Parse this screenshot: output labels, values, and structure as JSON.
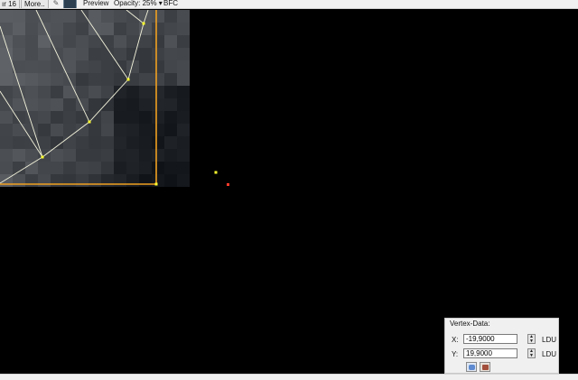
{
  "toolbar": {
    "grid_label": "ır 16",
    "more_label": "More..",
    "pencil_icon": "pencil-icon",
    "color_swatch": "#2b3f51",
    "preview_label": "Preview",
    "opacity_label": "Opacity: 25% ▾",
    "bfc_label": "BFC"
  },
  "canvas": {
    "background": "#000000",
    "accent_selection": "#f0a020",
    "vertex_color": "#ffff30",
    "cursor_color": "#ff3a2a"
  },
  "vertex_panel": {
    "title": "Vertex-Data:",
    "x_label": "X:",
    "x_value": "-19,9000",
    "y_label": "Y:",
    "y_value": "19,9000",
    "unit": "LDU",
    "spin_up": "▲",
    "spin_down": "▼",
    "tool1_icon": "copy-vertex-icon",
    "tool2_icon": "paste-vertex-icon"
  }
}
